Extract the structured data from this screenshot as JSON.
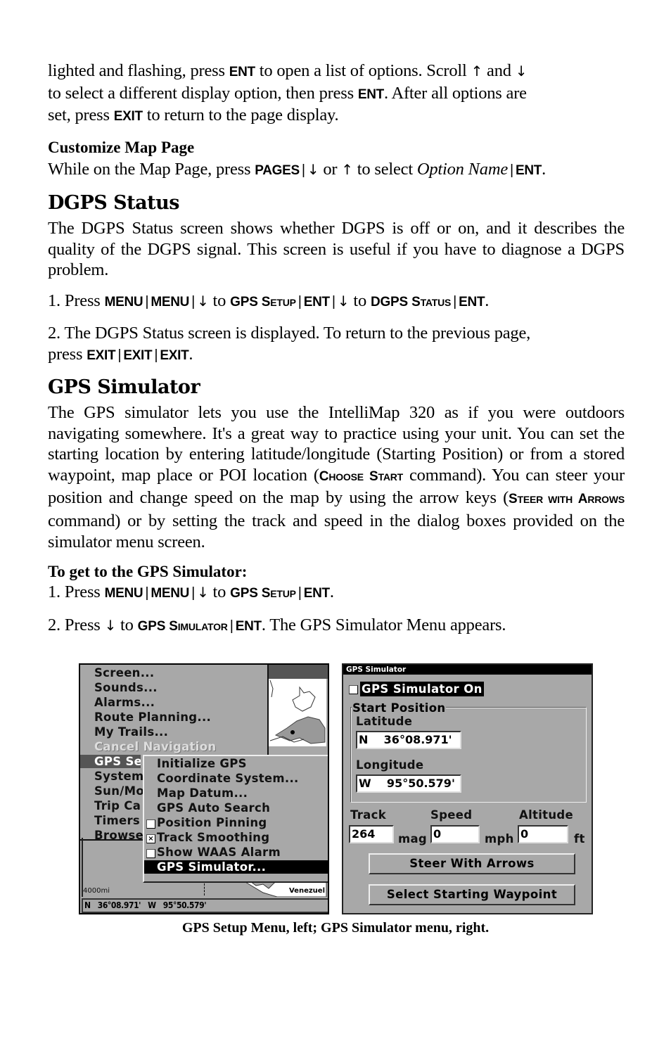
{
  "intro": {
    "line1_a": "lighted and flashing, press ",
    "line1_key": "ENT",
    "line1_b": " to open a list of options. Scroll ",
    "line1_up": "↑",
    "line1_c": " and ",
    "line1_down": "↓",
    "line2_a": "to select a different display option, then press ",
    "line2_key": "ENT",
    "line2_b": ". After all options are",
    "line3_a": "set, press ",
    "line3_key": "EXIT",
    "line3_b": " to return to the page display."
  },
  "customize": {
    "heading": "Customize Map Page",
    "text_a": "While on the Map Page, press ",
    "key_pages": "PAGES",
    "down": "↓",
    "or": " or ",
    "up": "↑",
    "text_b": " to select ",
    "option_name": "Option Name",
    "key_ent": "ENT",
    "end": "."
  },
  "dgps": {
    "heading": "DGPS Status",
    "paragraph": "The DGPS Status screen shows whether DGPS is off or on, and it describes the quality of the DGPS signal. This screen is useful if you have to diagnose a DGPS problem.",
    "step1": {
      "prefix": "1. Press ",
      "menu1": "MENU",
      "menu2": "MENU",
      "down1": "↓",
      "to1": " to ",
      "gps_setup_a": "GPS S",
      "gps_setup_b": "ETUP",
      "ent1": "ENT",
      "down2": "↓",
      "to2": " to ",
      "dgps_status_a": "DGPS S",
      "dgps_status_b": "TATUS",
      "ent2": "ENT",
      "end": "."
    },
    "step2": {
      "text": "2. The DGPS Status screen is displayed. To return to the previous page,",
      "prefix": "press ",
      "exit1": "EXIT",
      "exit2": "EXIT",
      "exit3": "EXIT",
      "end": "."
    }
  },
  "simulator": {
    "heading": "GPS Simulator",
    "para_a": "The GPS simulator lets you use the IntelliMap 320 as if you were outdoors navigating somewhere. It's a great way to practice using your unit. You can set the starting location by entering latitude/longitude (Starting Position) or from a stored waypoint, map place or POI location (",
    "choose_a": "C",
    "choose_b": "HOOSE",
    "start_a": "S",
    "start_b": "TART",
    "para_b": " command). You can steer your position and change speed on the map by using the arrow keys (",
    "steer_a": "S",
    "steer_b": "TEER WITH",
    "arrows_a": "A",
    "arrows_b": "RROWS",
    "para_c": " command) or by setting the track and speed in the dialog boxes provided on the simulator menu screen.",
    "to_get_heading": "To get to the GPS Simulator:",
    "step1": {
      "prefix": "1. Press ",
      "menu1": "MENU",
      "menu2": "MENU",
      "down": "↓",
      "to": " to ",
      "gps_setup_a": "GPS S",
      "gps_setup_b": "ETUP",
      "ent": "ENT",
      "end": "."
    },
    "step2": {
      "prefix": "2. Press ",
      "down": "↓",
      "to": " to ",
      "gps_sim_a": "GPS S",
      "gps_sim_b": "IMULATOR",
      "ent": "ENT",
      "suffix": ". The GPS Simulator Menu appears."
    }
  },
  "left_screen": {
    "main_menu": [
      {
        "label": "Screen...",
        "state": "normal"
      },
      {
        "label": "Sounds...",
        "state": "normal"
      },
      {
        "label": "Alarms...",
        "state": "normal"
      },
      {
        "label": "Route Planning...",
        "state": "normal"
      },
      {
        "label": "My Trails...",
        "state": "normal"
      },
      {
        "label": "Cancel Navigation",
        "state": "disabled"
      },
      {
        "label": "GPS Se",
        "state": "selected"
      },
      {
        "label": "System",
        "state": "normal"
      },
      {
        "label": "Sun/Mo",
        "state": "normal"
      },
      {
        "label": "Trip Ca",
        "state": "normal"
      },
      {
        "label": "Timers",
        "state": "normal"
      },
      {
        "label": "Browse",
        "state": "normal"
      }
    ],
    "submenu": [
      {
        "label": "Initialize GPS",
        "checkbox": null
      },
      {
        "label": "Coordinate System...",
        "checkbox": null
      },
      {
        "label": "Map Datum...",
        "checkbox": null
      },
      {
        "label": "GPS Auto Search",
        "checkbox": null
      },
      {
        "label": "Position Pinning",
        "checkbox": false
      },
      {
        "label": "Track Smoothing",
        "checkbox": true
      },
      {
        "label": "Show WAAS Alarm",
        "checkbox": false
      },
      {
        "label": "GPS Simulator...",
        "checkbox": null,
        "selected": true
      }
    ],
    "check_mark": "×",
    "scale_label": "4000mi",
    "map_place_label": "Venezuel",
    "coords": "N   36°08.971'   W   95°50.579'"
  },
  "right_screen": {
    "title": "GPS Simulator",
    "simulator_on_label": "GPS Simulator On",
    "simulator_on": false,
    "start_position_label": "Start Position",
    "latitude_label": "Latitude",
    "latitude_value": "N    36°08.971'",
    "longitude_label": "Longitude",
    "longitude_value": "W    95°50.579'",
    "track_label": "Track",
    "track_value": "264",
    "track_unit": "mag",
    "speed_label": "Speed",
    "speed_value": "0",
    "speed_unit": "mph",
    "altitude_label": "Altitude",
    "altitude_value": "0",
    "altitude_unit": "ft",
    "steer_button": "Steer With Arrows",
    "waypoint_button": "Select Starting Waypoint"
  },
  "caption": "GPS Setup Menu, left; GPS Simulator menu, right."
}
